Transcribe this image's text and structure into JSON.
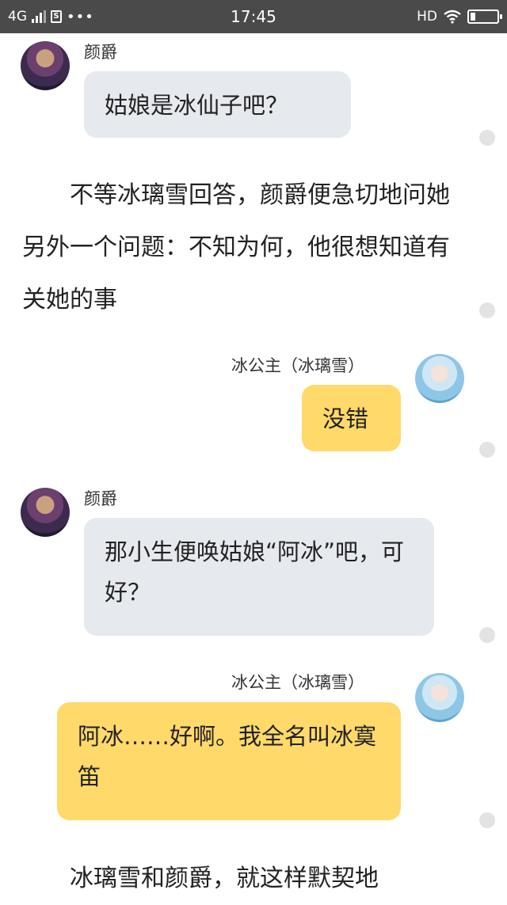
{
  "status_bar": {
    "network": "4G",
    "app_badge": "S",
    "more": "•••",
    "time": "17:45",
    "hd": "HD"
  },
  "messages": [
    {
      "type": "chat",
      "side": "left",
      "speaker": "颜爵",
      "text": "姑娘是冰仙子吧？"
    },
    {
      "type": "narration",
      "text": "不等冰璃雪回答，颜爵便急切地问她另外一个问题：不知为何，他很想知道有关她的事"
    },
    {
      "type": "chat",
      "side": "right",
      "speaker": "冰公主（冰璃雪）",
      "text": "没错"
    },
    {
      "type": "chat",
      "side": "left",
      "speaker": "颜爵",
      "text": "那小生便唤姑娘“阿冰”吧，可好？"
    },
    {
      "type": "chat",
      "side": "right",
      "speaker": "冰公主（冰璃雪）",
      "text": "阿冰……好啊。我全名叫冰寞笛"
    },
    {
      "type": "narration",
      "text": "冰璃雪和颜爵，就这样默契地"
    }
  ]
}
